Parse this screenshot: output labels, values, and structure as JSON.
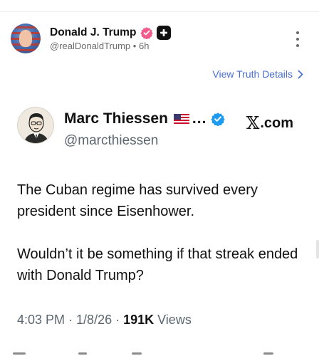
{
  "post": {
    "author_name": "Donald J. Trump",
    "author_handle": "@realDonaldTrump",
    "separator": "•",
    "time_ago": "6h",
    "view_details_label": "View Truth Details"
  },
  "embed": {
    "name": "Marc Thiessen",
    "ellipsis": "...",
    "handle": "@marcthiessen",
    "brand": ".com",
    "brand_logo": "𝕏",
    "text": "The Cuban regime has survived every president since Eisenhower.\n\nWouldn’t it be something if that streak ended with Donald Trump?",
    "time": "4:03 PM",
    "dot1": "·",
    "date": "1/8/26",
    "dot2": "·",
    "views_count": "191K",
    "views_label": "Views"
  },
  "colors": {
    "link_blue": "#4a6fd1",
    "verified_pink": "#f25c8a",
    "x_verified_blue": "#1d9bf0"
  },
  "icons": {
    "verified": "verified-badge-icon",
    "plus": "plus-badge-icon",
    "more": "kebab-menu-icon",
    "chevron": "chevron-right-icon",
    "flag": "us-flag-icon"
  }
}
